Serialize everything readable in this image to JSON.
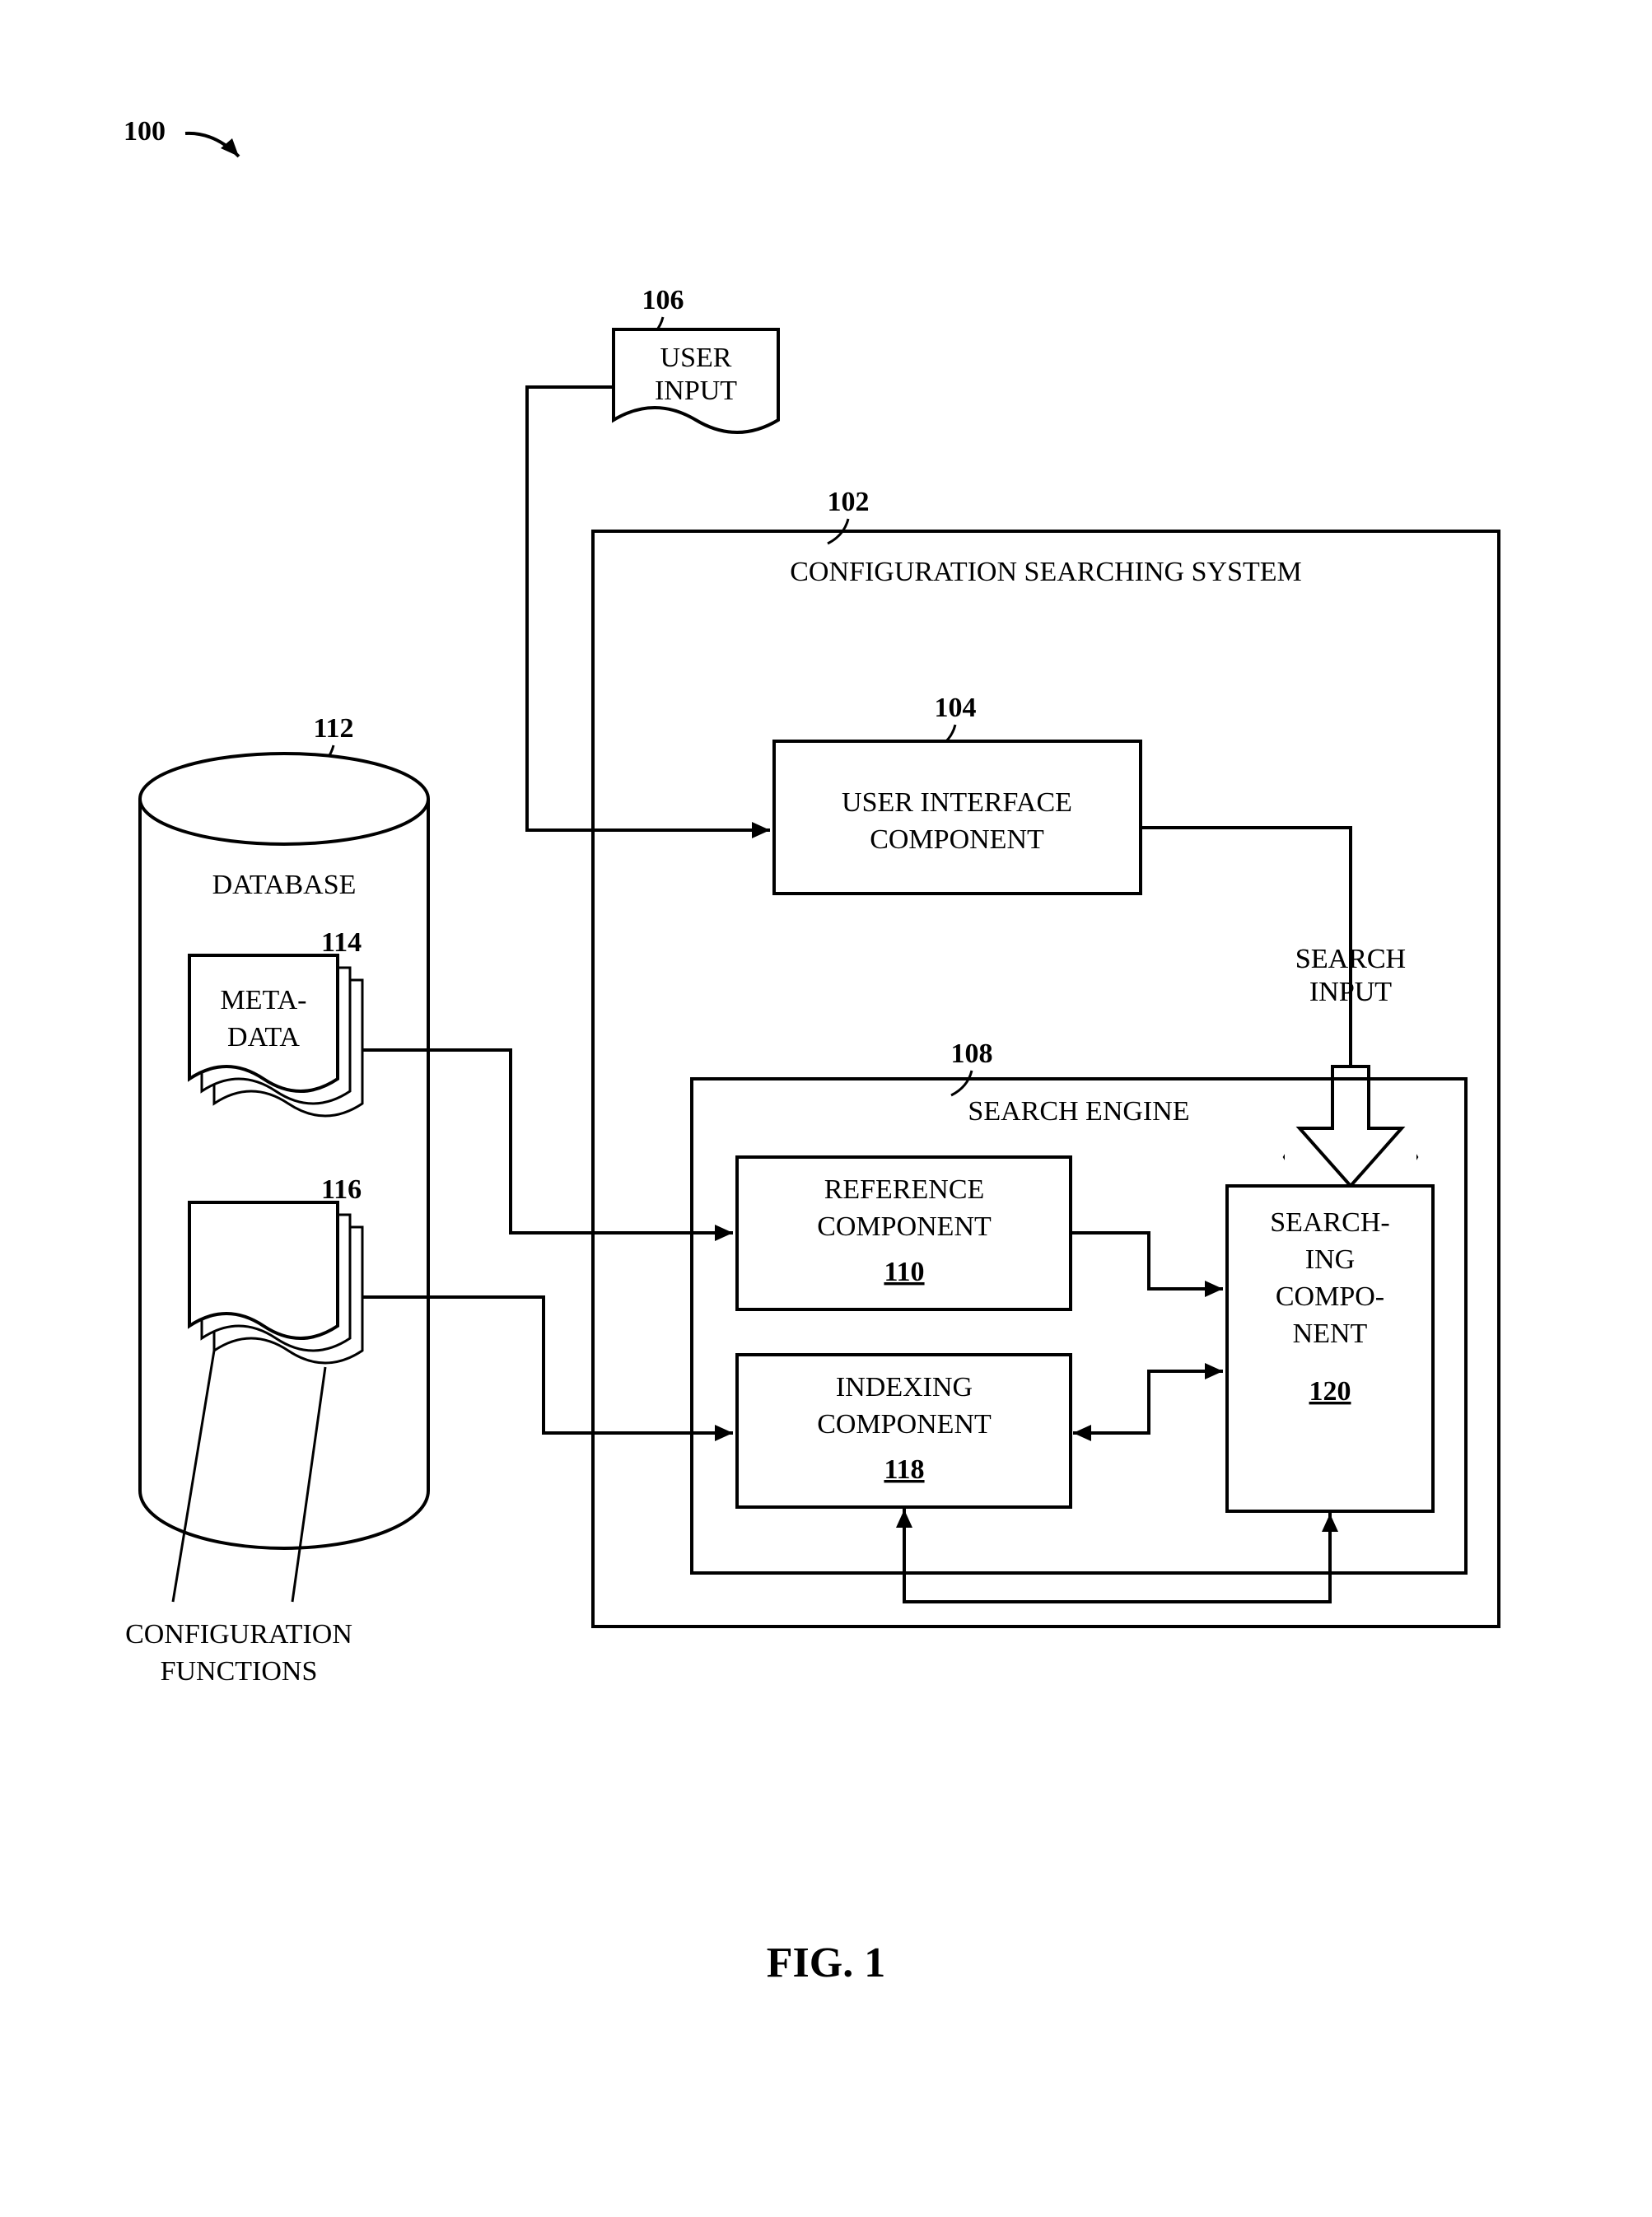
{
  "figure": {
    "system_ref": "100",
    "title": "FIG. 1"
  },
  "user_input": {
    "ref": "106",
    "line1": "USER",
    "line2": "INPUT"
  },
  "config_system": {
    "ref": "102",
    "title": "CONFIGURATION SEARCHING SYSTEM"
  },
  "ui_component": {
    "ref": "104",
    "line1": "USER INTERFACE",
    "line2": "COMPONENT"
  },
  "search_input": {
    "line1": "SEARCH",
    "line2": "INPUT"
  },
  "search_engine": {
    "ref": "108",
    "title": "SEARCH ENGINE"
  },
  "reference_component": {
    "line1": "REFERENCE",
    "line2": "COMPONENT",
    "ref": "110"
  },
  "indexing_component": {
    "line1": "INDEXING",
    "line2": "COMPONENT",
    "ref": "118"
  },
  "searching_component": {
    "line1": "SEARCH-",
    "line2": "ING",
    "line3": "COMPO-",
    "line4": "NENT",
    "ref": "120"
  },
  "database": {
    "ref": "112",
    "title": "DATABASE"
  },
  "metadata": {
    "ref": "114",
    "line1": "META-",
    "line2": "DATA"
  },
  "config_functions_stack": {
    "ref": "116"
  },
  "config_functions_label": {
    "line1": "CONFIGURATION",
    "line2": "FUNCTIONS"
  }
}
